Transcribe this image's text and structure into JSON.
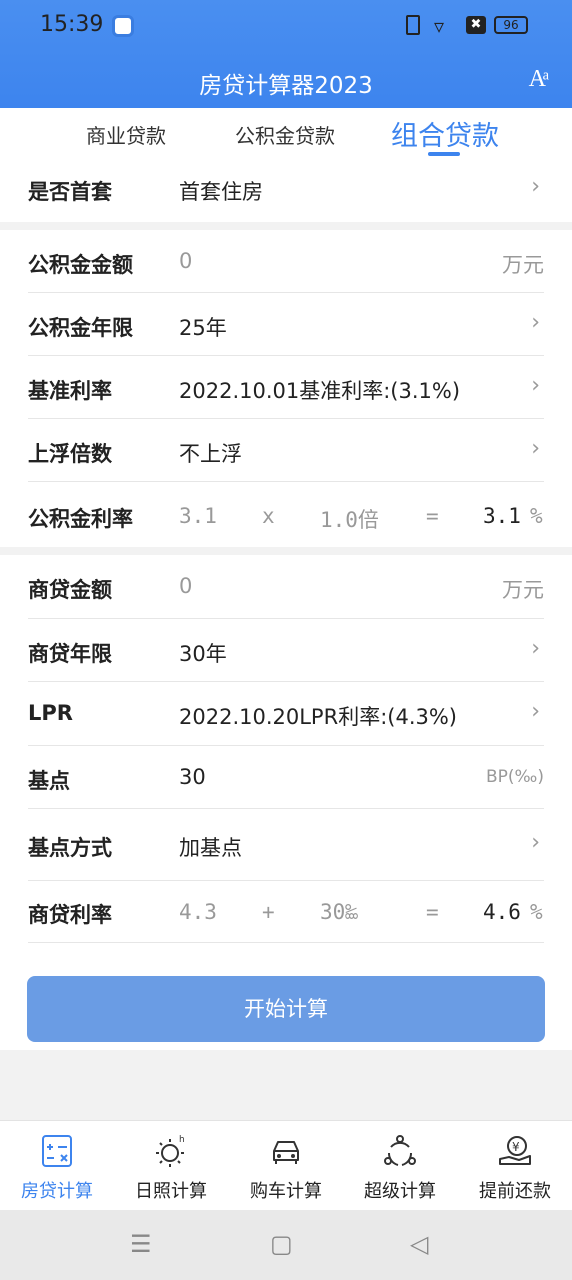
{
  "status_bar": {
    "time": "15:39",
    "battery": "96",
    "wifi": "▿",
    "x_box": "✖"
  },
  "header": {
    "title": "房贷计算器2023",
    "font_icon": "Aͣ"
  },
  "tabs": [
    {
      "label": "商业贷款",
      "active": false
    },
    {
      "label": "公积金贷款",
      "active": false
    },
    {
      "label": "组合贷款",
      "active": true
    }
  ],
  "first_home": {
    "label": "是否首套",
    "value": "首套住房"
  },
  "fund": {
    "amount": {
      "label": "公积金金额",
      "placeholder": "0",
      "unit": "万元"
    },
    "years": {
      "label": "公积金年限",
      "value": "25年"
    },
    "base_rate": {
      "label": "基准利率",
      "value": "2022.10.01基准利率:(3.1%)"
    },
    "float": {
      "label": "上浮倍数",
      "value": "不上浮"
    },
    "rate": {
      "label": "公积金利率",
      "base": "3.1",
      "op": "x",
      "multiplier": "1.0倍",
      "eq": "=",
      "result": "3.1",
      "unit": "%"
    }
  },
  "commercial": {
    "amount": {
      "label": "商贷金额",
      "placeholder": "0",
      "unit": "万元"
    },
    "years": {
      "label": "商贷年限",
      "value": "30年"
    },
    "lpr": {
      "label": "LPR",
      "value": "2022.10.20LPR利率:(4.3%)"
    },
    "bp": {
      "label": "基点",
      "value": "30",
      "unit": "BP(‰)"
    },
    "bp_mode": {
      "label": "基点方式",
      "value": "加基点"
    },
    "rate": {
      "label": "商贷利率",
      "base": "4.3",
      "op": "+",
      "bp": "30‱",
      "eq": "=",
      "result": "4.6",
      "unit": "%"
    }
  },
  "chevron": "›",
  "start_button": "开始计算",
  "bottom_nav": [
    {
      "label": "房贷计算",
      "icon": "calculator-icon",
      "active": true
    },
    {
      "label": "日照计算",
      "icon": "sun-icon",
      "active": false
    },
    {
      "label": "购车计算",
      "icon": "car-icon",
      "active": false
    },
    {
      "label": "超级计算",
      "icon": "nodes-icon",
      "active": false
    },
    {
      "label": "提前还款",
      "icon": "yen-hand-icon",
      "active": false
    }
  ],
  "system_nav": {
    "menu": "☰",
    "home": "▢",
    "back": "◁"
  },
  "colors": {
    "accent": "#3d84ee",
    "button": "#6a9ce4"
  }
}
